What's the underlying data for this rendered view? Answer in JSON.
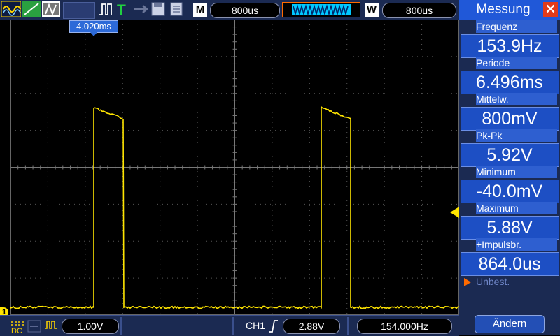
{
  "top_bar": {
    "mode_label": "M",
    "mode_value": "800us",
    "window_label": "W",
    "window_value": "800us"
  },
  "cursor": {
    "time_label": "4.020ms"
  },
  "measurements": {
    "title": "Messung",
    "items": [
      {
        "label": "Frequenz",
        "value": "153.9Hz"
      },
      {
        "label": "Periode",
        "value": "6.496ms"
      },
      {
        "label": "Mittelw.",
        "value": "800mV"
      },
      {
        "label": "Pk-Pk",
        "value": "5.92V"
      },
      {
        "label": "Minimum",
        "value": "-40.0mV"
      },
      {
        "label": "Maximum",
        "value": "5.88V"
      },
      {
        "label": "+Impulsbr.",
        "value": "864.0us"
      }
    ],
    "more_label": "Unbest.",
    "change_button": "Ändern"
  },
  "bottom_bar": {
    "volts_div": "1.00V",
    "trigger_channel": "CH1",
    "trigger_level": "2.88V",
    "trigger_freq": "154.000Hz",
    "ch1_marker": "1"
  },
  "colors": {
    "trace": "#ffe500",
    "panel_bg": "#1b2a52",
    "header_blue": "#2058d8",
    "close_red": "#e23a1a"
  }
}
